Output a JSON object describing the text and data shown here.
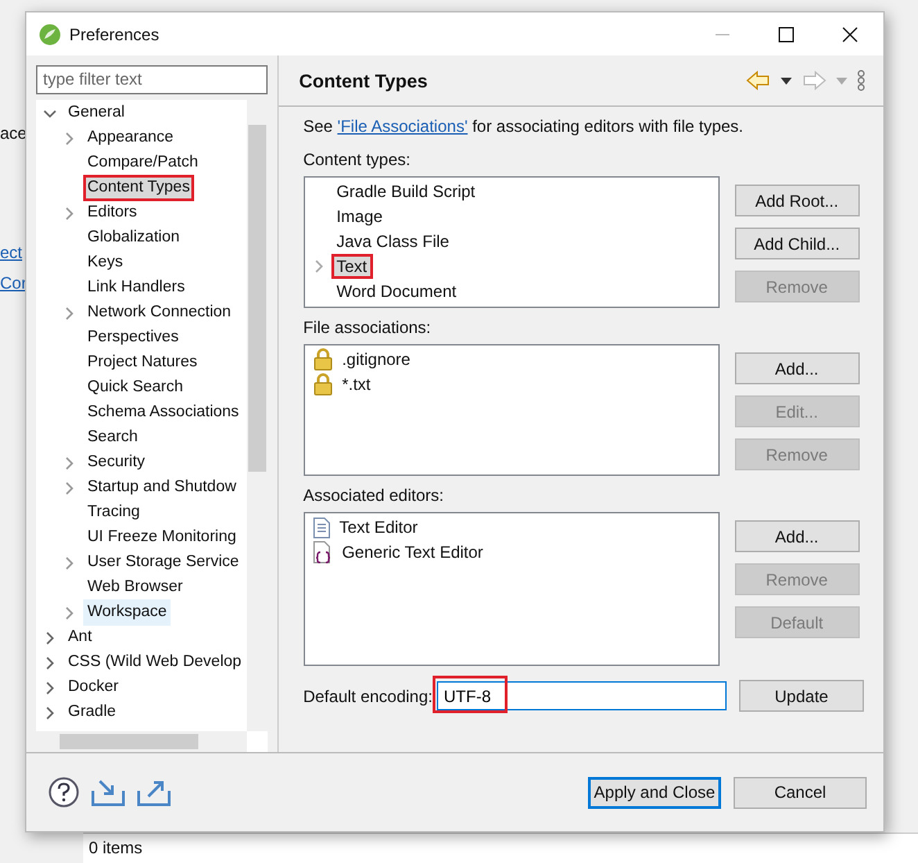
{
  "background": {
    "texts": [
      "ace",
      "ect",
      "Cor"
    ],
    "status": "0 items"
  },
  "window": {
    "title": "Preferences"
  },
  "filter": {
    "placeholder": "type filter text"
  },
  "tree": [
    {
      "label": "General",
      "expanded": true,
      "selected": false,
      "children": [
        {
          "label": "Appearance",
          "expanded": false,
          "selected": false
        },
        {
          "label": "Compare/Patch",
          "selected": false
        },
        {
          "label": "Content Types",
          "selected": true,
          "annotated": true
        },
        {
          "label": "Editors",
          "expanded": false,
          "selected": false
        },
        {
          "label": "Globalization",
          "selected": false
        },
        {
          "label": "Keys",
          "selected": false
        },
        {
          "label": "Link Handlers",
          "selected": false
        },
        {
          "label": "Network Connection",
          "expanded": false,
          "selected": false
        },
        {
          "label": "Perspectives",
          "selected": false
        },
        {
          "label": "Project Natures",
          "selected": false
        },
        {
          "label": "Quick Search",
          "selected": false
        },
        {
          "label": "Schema Associations",
          "selected": false
        },
        {
          "label": "Search",
          "selected": false
        },
        {
          "label": "Security",
          "expanded": false,
          "selected": false
        },
        {
          "label": "Startup and Shutdow",
          "expanded": false,
          "selected": false
        },
        {
          "label": "Tracing",
          "selected": false
        },
        {
          "label": "UI Freeze Monitoring",
          "selected": false
        },
        {
          "label": "User Storage Service",
          "expanded": false,
          "selected": false
        },
        {
          "label": "Web Browser",
          "selected": false
        },
        {
          "label": "Workspace",
          "expanded": false,
          "selected": false,
          "hovered": true
        }
      ]
    },
    {
      "label": "Ant",
      "expanded": false,
      "selected": false
    },
    {
      "label": "CSS (Wild Web Develop",
      "expanded": false,
      "selected": false
    },
    {
      "label": "Docker",
      "expanded": false,
      "selected": false
    },
    {
      "label": "Gradle",
      "expanded": false,
      "selected": false
    }
  ],
  "page": {
    "title": "Content Types",
    "intro": {
      "before": "See",
      "link": "'File Associations'",
      "after": "for associating editors with file types."
    },
    "content_types": {
      "label": "Content types:",
      "items": [
        {
          "label": "Gradle Build Script",
          "selected": false
        },
        {
          "label": "Image",
          "selected": false
        },
        {
          "label": "Java Class File",
          "selected": false
        },
        {
          "label": "Text",
          "expanded": false,
          "selected": true,
          "annotated": true
        },
        {
          "label": "Word Document",
          "selected": false
        }
      ],
      "buttons": [
        {
          "label": "Add Root...",
          "disabled": false
        },
        {
          "label": "Add Child...",
          "disabled": false
        },
        {
          "label": "Remove",
          "disabled": true
        }
      ]
    },
    "file_associations": {
      "label": "File associations:",
      "items": [
        {
          "label": ".gitignore",
          "kind": "locked"
        },
        {
          "label": "*.txt",
          "kind": "locked"
        }
      ],
      "buttons": [
        {
          "label": "Add...",
          "disabled": false
        },
        {
          "label": "Edit...",
          "disabled": true
        },
        {
          "label": "Remove",
          "disabled": true
        }
      ]
    },
    "associated_editors": {
      "label": "Associated editors:",
      "items": [
        {
          "label": "Text Editor",
          "kind": "text"
        },
        {
          "label": "Generic Text Editor",
          "kind": "generic"
        }
      ],
      "buttons": [
        {
          "label": "Add...",
          "disabled": false
        },
        {
          "label": "Remove",
          "disabled": true
        },
        {
          "label": "Default",
          "disabled": true
        }
      ]
    },
    "encoding": {
      "label": "Default encoding:",
      "value": "UTF-8",
      "annotated": true,
      "button": "Update"
    }
  },
  "footer": {
    "buttons": [
      {
        "label": "Apply and Close",
        "default": true
      },
      {
        "label": "Cancel",
        "default": false
      }
    ]
  }
}
